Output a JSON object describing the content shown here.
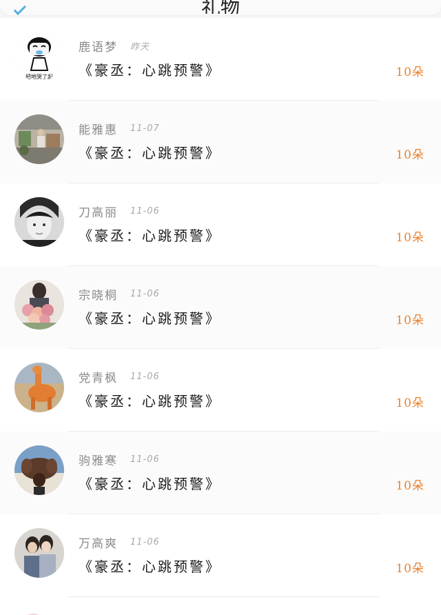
{
  "header": {
    "title": "礼物"
  },
  "gift_list": [
    {
      "name": "鹿语梦",
      "date": "昨天",
      "gift": "《豪丞：心跳预警》",
      "count": "10朵"
    },
    {
      "name": "能雅惠",
      "date": "11-07",
      "gift": "《豪丞：心跳预警》",
      "count": "10朵"
    },
    {
      "name": "刀高丽",
      "date": "11-06",
      "gift": "《豪丞：心跳预警》",
      "count": "10朵"
    },
    {
      "name": "宗晓桐",
      "date": "11-06",
      "gift": "《豪丞：心跳预警》",
      "count": "10朵"
    },
    {
      "name": "党青枫",
      "date": "11-06",
      "gift": "《豪丞：心跳预警》",
      "count": "10朵"
    },
    {
      "name": "驹雅寒",
      "date": "11-06",
      "gift": "《豪丞：心跳预警》",
      "count": "10朵"
    },
    {
      "name": "万高爽",
      "date": "11-06",
      "gift": "《豪丞：心跳预警》",
      "count": "10朵"
    }
  ],
  "avatar_caption": "把地哭了起",
  "colors": {
    "count": "#e8822f",
    "name": "#8a8a8a",
    "gift": "#1c1c1c",
    "date": "#a9a9a9"
  },
  "icons": {
    "back": "back-arrow-icon"
  }
}
